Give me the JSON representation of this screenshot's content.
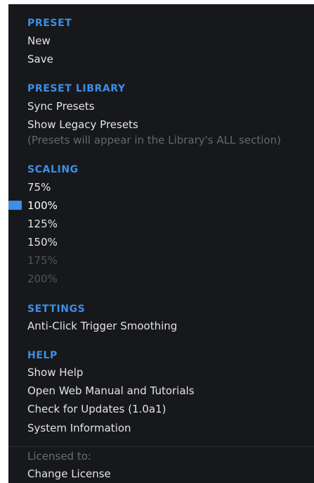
{
  "colors": {
    "accent": "#3d8fe6",
    "menu_background": "#17181b",
    "text": "#e3e3e3",
    "disabled_text": "#505255"
  },
  "preset": {
    "title": "PRESET",
    "items": [
      "New",
      "Save"
    ]
  },
  "preset_library": {
    "title": "PRESET LIBRARY",
    "items": [
      "Sync Presets",
      "Show Legacy Presets"
    ],
    "note": "(Presets will appear in the Library's ALL section)"
  },
  "scaling": {
    "title": "SCALING",
    "selected": "100%",
    "options": [
      {
        "label": "75%",
        "enabled": true
      },
      {
        "label": "100%",
        "enabled": true
      },
      {
        "label": "125%",
        "enabled": true
      },
      {
        "label": "150%",
        "enabled": true
      },
      {
        "label": "175%",
        "enabled": false
      },
      {
        "label": "200%",
        "enabled": false
      }
    ]
  },
  "settings": {
    "title": "SETTINGS",
    "items": [
      "Anti-Click Trigger Smoothing"
    ]
  },
  "help": {
    "title": "HELP",
    "items": [
      "Show Help",
      "Open Web Manual and Tutorials",
      "Check for Updates (1.0a1)",
      "System Information"
    ]
  },
  "license": {
    "licensed_to_label": "Licensed to:",
    "change_license": "Change License"
  }
}
